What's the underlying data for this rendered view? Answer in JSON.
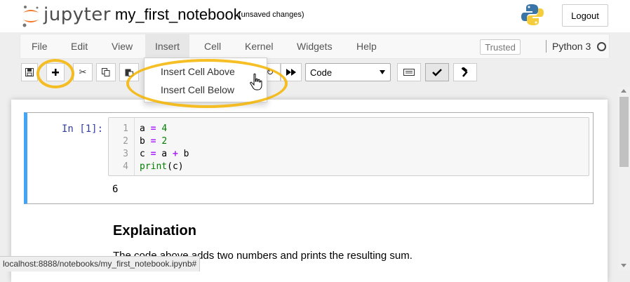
{
  "header": {
    "brand": "jupyter",
    "notebook_name": "my_first_notebook",
    "save_status": "(unsaved changes)",
    "logout_label": "Logout"
  },
  "menubar": {
    "items": [
      "File",
      "Edit",
      "View",
      "Insert",
      "Cell",
      "Kernel",
      "Widgets",
      "Help"
    ],
    "trusted_label": "Trusted",
    "kernel_name": "Python 3"
  },
  "toolbar": {
    "cell_type": "Code",
    "icons": [
      "save-icon",
      "plus-icon",
      "cut-icon",
      "copy-icon",
      "paste-icon",
      "fast-forward-icon",
      "keyboard-icon",
      "check-icon",
      "hammer-icon"
    ]
  },
  "insert_menu": {
    "items": [
      "Insert Cell Above",
      "Insert Cell Below"
    ]
  },
  "cell": {
    "prompt": "In [1]:",
    "line_numbers": [
      "1",
      "2",
      "3",
      "4"
    ],
    "output": "6"
  },
  "markdown": {
    "heading": "Explaination",
    "text": "The code above adds two numbers and prints the resulting sum."
  },
  "statusbar": {
    "url": "localhost:8888/notebooks/my_first_notebook.ipynb#"
  },
  "colors": {
    "highlight": "#f4b400",
    "cell_border_active": "#42a5f5",
    "prompt": "#303f9f"
  }
}
